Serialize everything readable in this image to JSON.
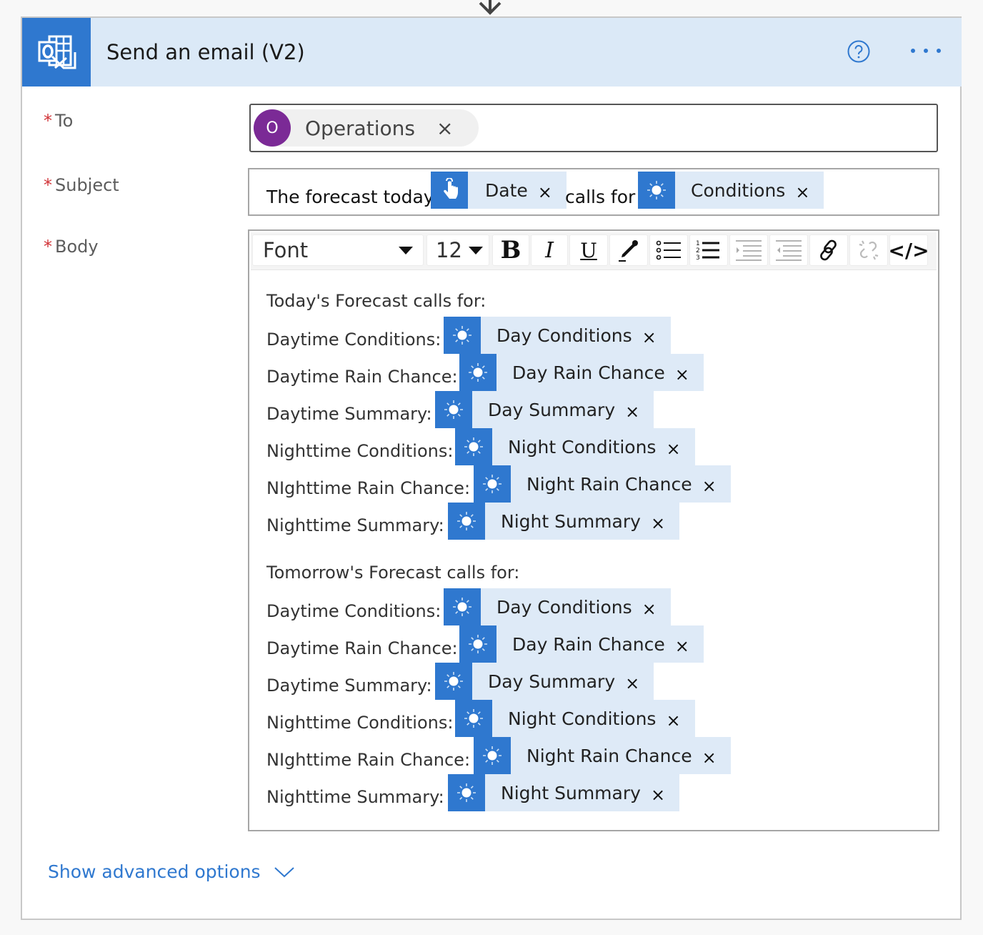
{
  "action": {
    "title": "Send an email (V2)",
    "icon": "outlook-icon",
    "help_icon": "help-circle-icon",
    "more_icon": "more-ellipsis-icon"
  },
  "fields": {
    "to": {
      "label": "To",
      "required_mark": "*",
      "recipient": {
        "initial": "O",
        "name": "Operations",
        "remove": "×",
        "avatar_color": "#7b2a96"
      }
    },
    "subject": {
      "label": "Subject",
      "required_mark": "*",
      "text1": "The forecast today",
      "token1": {
        "label": "Date",
        "icon": "touch-icon",
        "remove": "×"
      },
      "text2": "calls for",
      "token2": {
        "label": "Conditions",
        "icon": "sun-icon",
        "remove": "×"
      }
    },
    "body": {
      "label": "Body",
      "required_mark": "*",
      "toolbar": {
        "font": "Font",
        "size": "12",
        "bold": "B",
        "italic": "I",
        "underline": "U",
        "code": "</>"
      },
      "today_heading": "Today's Forecast calls for:",
      "today": [
        {
          "label": "Daytime Conditions:",
          "token": "Day Conditions"
        },
        {
          "label": "Daytime Rain Chance:",
          "token": "Day Rain Chance"
        },
        {
          "label": "Daytime Summary:",
          "token": "Day Summary"
        },
        {
          "label": "Nighttime Conditions:",
          "token": "Night Conditions"
        },
        {
          "label": "NIghttime Rain Chance:",
          "token": "Night Rain Chance"
        },
        {
          "label": "Nighttime Summary:",
          "token": "Night Summary"
        }
      ],
      "tomorrow_heading": "Tomorrow's Forecast calls for:",
      "tomorrow": [
        {
          "label": "Daytime Conditions:",
          "token": "Day Conditions"
        },
        {
          "label": "Daytime Rain Chance:",
          "token": "Day Rain Chance"
        },
        {
          "label": "Daytime Summary:",
          "token": "Day Summary"
        },
        {
          "label": "Nighttime Conditions:",
          "token": "Night Conditions"
        },
        {
          "label": "NIghttime Rain Chance:",
          "token": "Night Rain Chance"
        },
        {
          "label": "Nighttime Summary:",
          "token": "Night Summary"
        }
      ],
      "token_remove": "×"
    }
  },
  "advanced": {
    "label": "Show advanced options"
  },
  "colors": {
    "accent": "#2f78cf",
    "header_bg": "#dbe9f7",
    "token_bg": "#deeaf7",
    "required": "#d13438"
  }
}
